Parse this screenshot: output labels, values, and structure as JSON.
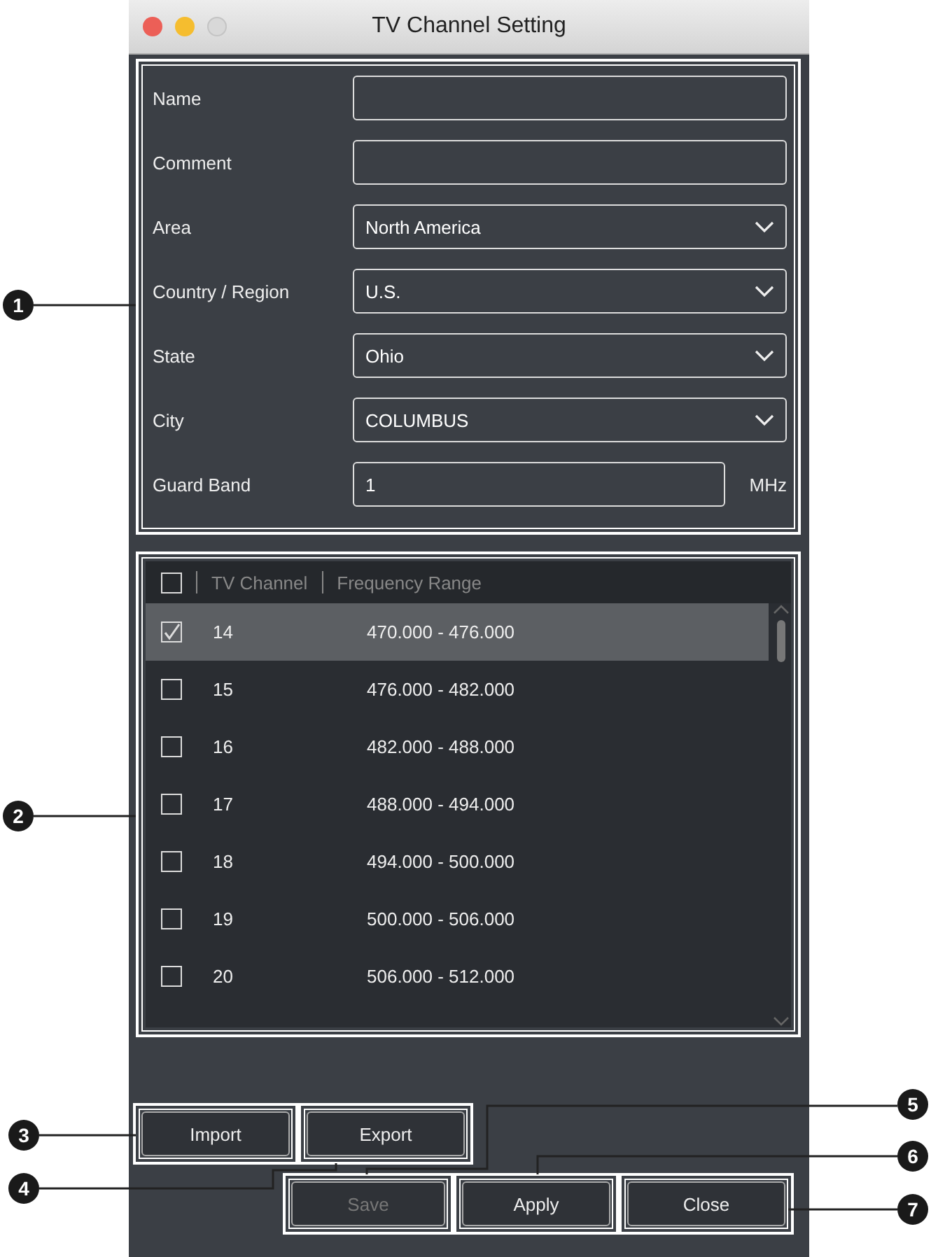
{
  "window": {
    "title": "TV Channel Setting"
  },
  "form": {
    "fields": [
      {
        "label": "Name",
        "kind": "text"
      },
      {
        "label": "Comment",
        "kind": "text"
      },
      {
        "label": "Area",
        "kind": "dropdown",
        "value": "North America"
      },
      {
        "label": "Country / Region",
        "kind": "dropdown",
        "value": "U.S."
      },
      {
        "label": "State",
        "kind": "dropdown",
        "value": "Ohio"
      },
      {
        "label": "City",
        "kind": "dropdown",
        "value": "COLUMBUS"
      },
      {
        "label": "Guard Band",
        "kind": "text",
        "value": "1",
        "unit": "MHz"
      }
    ]
  },
  "table": {
    "select_all_checked": false,
    "columns": [
      "TV Channel",
      "Frequency Range"
    ],
    "rows": [
      {
        "channel": "14",
        "range": "470.000 - 476.000",
        "checked": true,
        "selected": true
      },
      {
        "channel": "15",
        "range": "476.000 - 482.000",
        "checked": false,
        "selected": false
      },
      {
        "channel": "16",
        "range": "482.000 - 488.000",
        "checked": false,
        "selected": false
      },
      {
        "channel": "17",
        "range": "488.000 - 494.000",
        "checked": false,
        "selected": false
      },
      {
        "channel": "18",
        "range": "494.000 - 500.000",
        "checked": false,
        "selected": false
      },
      {
        "channel": "19",
        "range": "500.000 - 506.000",
        "checked": false,
        "selected": false
      },
      {
        "channel": "20",
        "range": "506.000 - 512.000",
        "checked": false,
        "selected": false
      }
    ]
  },
  "buttons": [
    {
      "label": "Import",
      "disabled": false
    },
    {
      "label": "Export",
      "disabled": false
    },
    {
      "label": "Save",
      "disabled": true
    },
    {
      "label": "Apply",
      "disabled": false
    },
    {
      "label": "Close",
      "disabled": false
    }
  ],
  "callouts": [
    "1",
    "2",
    "3",
    "4",
    "5",
    "6",
    "7"
  ]
}
